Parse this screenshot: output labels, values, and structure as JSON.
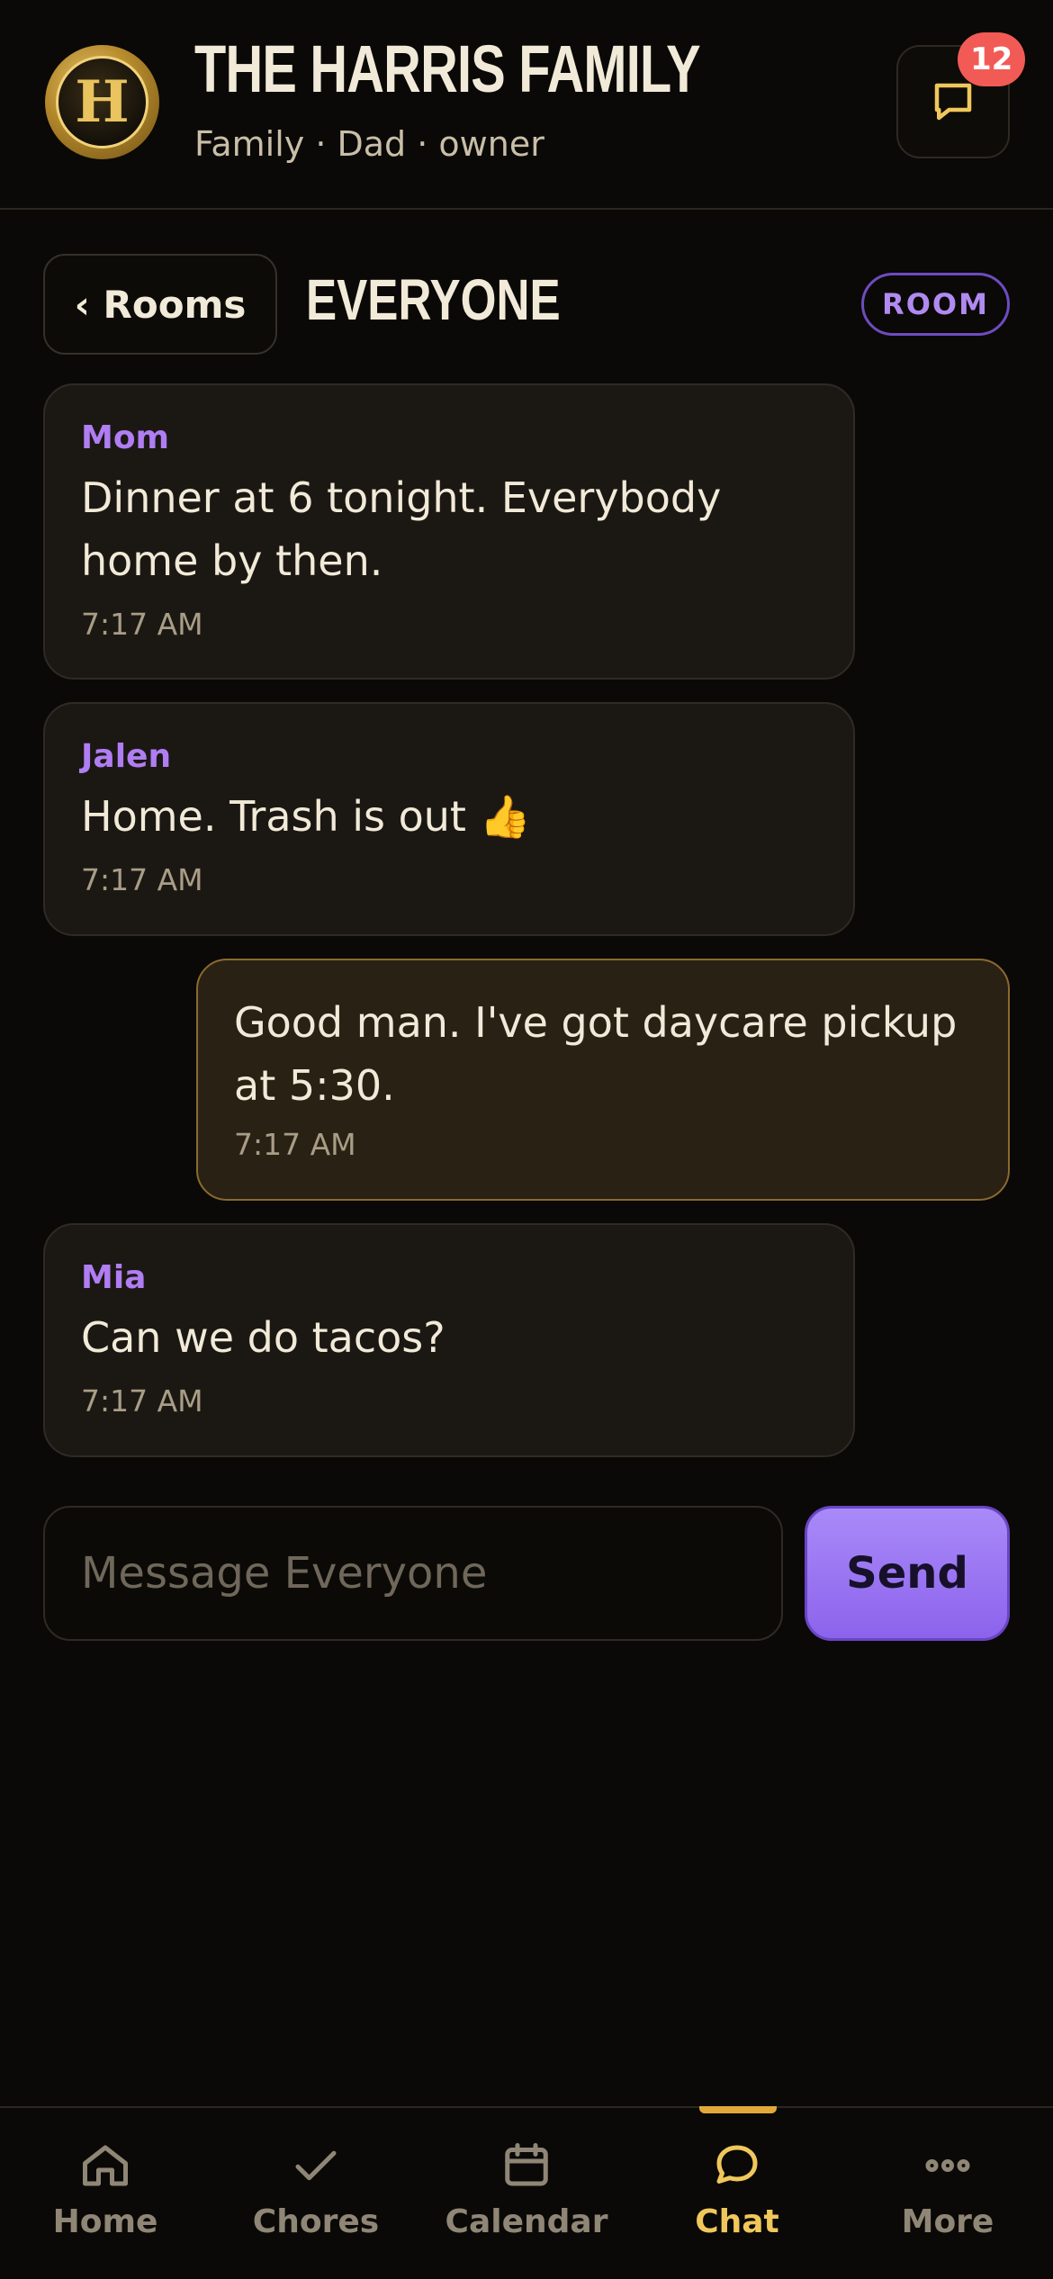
{
  "header": {
    "logo_letter": "H",
    "title": "THE HARRIS FAMILY",
    "subtitle": "Family · Dad · owner",
    "notification_count": "12",
    "notification_icon": "chat-bubble-icon"
  },
  "room_bar": {
    "back_label": "‹ Rooms",
    "room_name": "EVERYONE",
    "room_tag": "ROOM"
  },
  "messages": [
    {
      "sender": "Mom",
      "text": "Dinner at 6 tonight. Everybody home by then.",
      "time": "7:17 AM",
      "mine": false
    },
    {
      "sender": "Jalen",
      "text": "Home. Trash is out 👍",
      "time": "7:17 AM",
      "mine": false
    },
    {
      "sender": "",
      "text": "Good man. I've got daycare pickup at 5:30.",
      "time": "7:17 AM",
      "mine": true
    },
    {
      "sender": "Mia",
      "text": "Can we do tacos?",
      "time": "7:17 AM",
      "mine": false
    }
  ],
  "composer": {
    "placeholder": "Message Everyone",
    "value": "",
    "send_label": "Send"
  },
  "nav": {
    "items": [
      {
        "label": "Home",
        "icon": "home-icon",
        "active": false
      },
      {
        "label": "Chores",
        "icon": "check-icon",
        "active": false
      },
      {
        "label": "Calendar",
        "icon": "calendar-icon",
        "active": false
      },
      {
        "label": "Chat",
        "icon": "chat-bubble-icon",
        "active": true
      },
      {
        "label": "More",
        "icon": "more-dots-icon",
        "active": false
      }
    ]
  },
  "colors": {
    "background": "#0a0907",
    "accent_gold": "#f0c75a",
    "accent_purple": "#b07df2",
    "badge_red": "#f25b55"
  }
}
